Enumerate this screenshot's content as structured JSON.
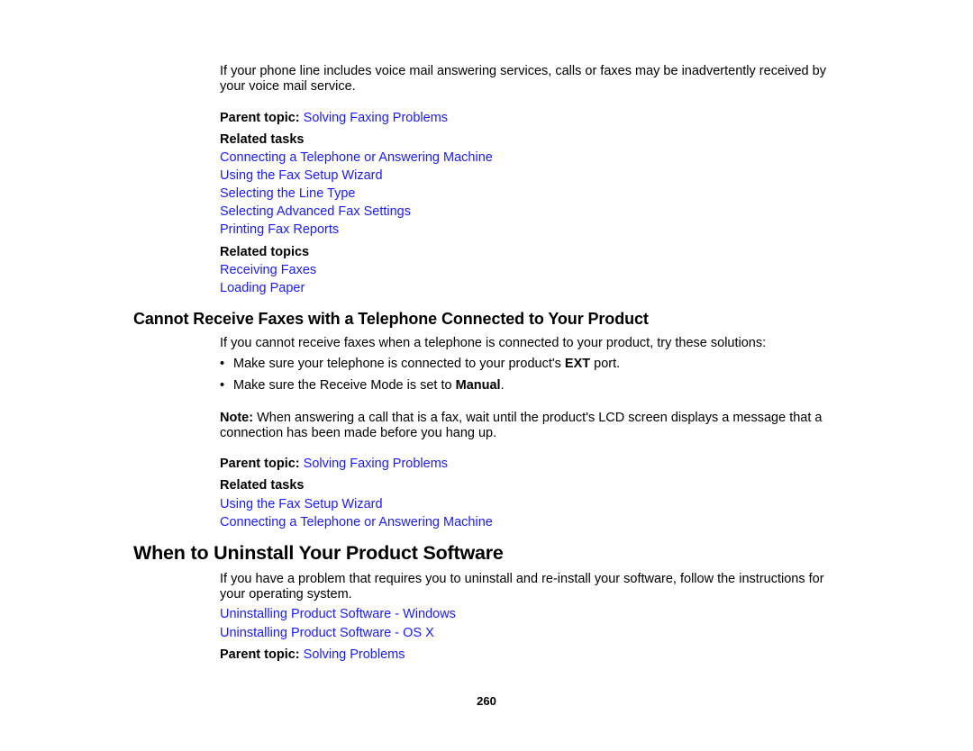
{
  "section1": {
    "intro": "If your phone line includes voice mail answering services, calls or faxes may be inadvertently received by your voice mail service.",
    "parent_topic_label": "Parent topic:",
    "parent_topic_link": "Solving Faxing Problems",
    "related_tasks_label": "Related tasks",
    "related_tasks": [
      "Connecting a Telephone or Answering Machine",
      "Using the Fax Setup Wizard",
      "Selecting the Line Type",
      "Selecting Advanced Fax Settings",
      "Printing Fax Reports"
    ],
    "related_topics_label": "Related topics",
    "related_topics": [
      "Receiving Faxes",
      "Loading Paper"
    ]
  },
  "section2": {
    "heading": "Cannot Receive Faxes with a Telephone Connected to Your Product",
    "intro": "If you cannot receive faxes when a telephone is connected to your product, try these solutions:",
    "bullets": [
      {
        "before": "Make sure your telephone is connected to your product's ",
        "bold": "EXT",
        "after": " port."
      },
      {
        "before": "Make sure the Receive Mode is set to ",
        "bold": "Manual",
        "after": "."
      }
    ],
    "bullet_glyph": "•",
    "note_label": "Note:",
    "note_text": " When answering a call that is a fax, wait until the product's LCD screen displays a message that a connection has been made before you hang up.",
    "parent_topic_label": "Parent topic:",
    "parent_topic_link": "Solving Faxing Problems",
    "related_tasks_label": "Related tasks",
    "related_tasks": [
      "Using the Fax Setup Wizard",
      "Connecting a Telephone or Answering Machine"
    ]
  },
  "section3": {
    "heading": "When to Uninstall Your Product Software",
    "intro": "If you have a problem that requires you to uninstall and re-install your software, follow the instructions for your operating system.",
    "links": [
      "Uninstalling Product Software - Windows",
      "Uninstalling Product Software - OS X"
    ],
    "parent_topic_label": "Parent topic:",
    "parent_topic_link": "Solving Problems"
  },
  "footer": {
    "page_number": "260"
  },
  "colors": {
    "link": "#1a1aff",
    "text": "#000000",
    "background": "#ffffff"
  }
}
